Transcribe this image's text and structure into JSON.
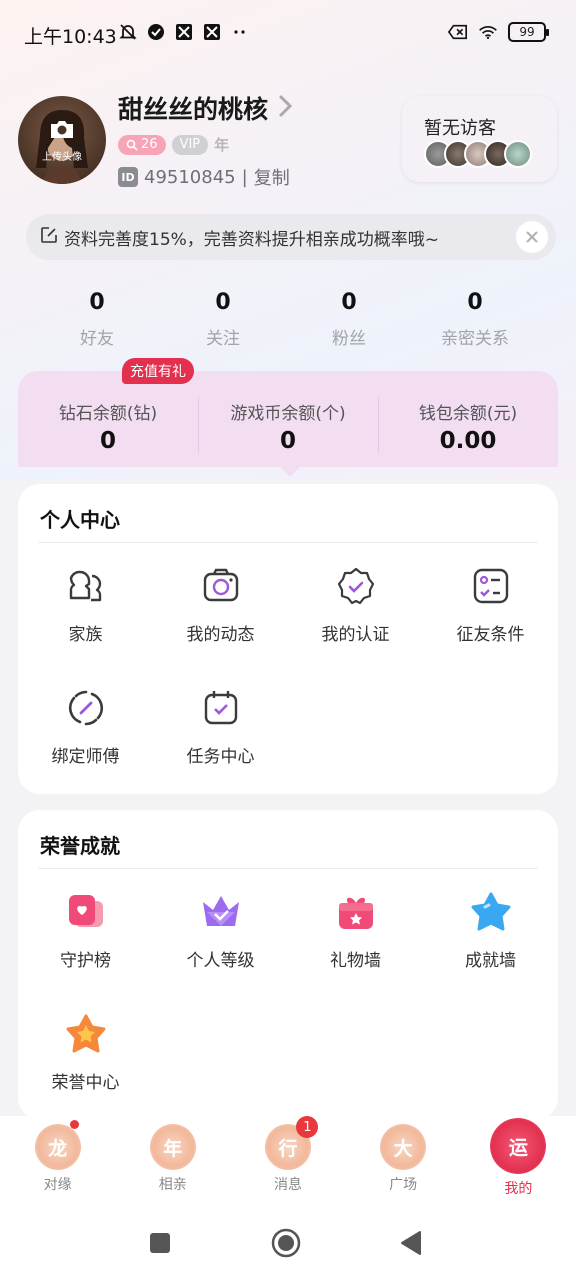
{
  "status_bar": {
    "time": "上午10:43",
    "battery": "99",
    "icons_left": [
      "muted-bell-icon",
      "check-circle-icon",
      "app-icon",
      "app-icon",
      "more-icon"
    ],
    "icons_right": [
      "sim-off-icon",
      "wifi-icon",
      "battery-icon"
    ]
  },
  "profile": {
    "avatar_label": "上传头像",
    "name": "甜丝丝的桃核",
    "level": "26",
    "vip": "VIP",
    "vip_period": "年",
    "id_tag": "ID",
    "id": "49510845",
    "separator": "|",
    "copy_label": "复制"
  },
  "visitors": {
    "title": "暂无访客"
  },
  "banner": {
    "text": "资料完善度15%，完善资料提升相亲成功概率哦~"
  },
  "stats": [
    {
      "value": "0",
      "label": "好友"
    },
    {
      "value": "0",
      "label": "关注"
    },
    {
      "value": "0",
      "label": "粉丝"
    },
    {
      "value": "0",
      "label": "亲密关系"
    }
  ],
  "wallet": {
    "badge": "充值有礼",
    "items": [
      {
        "label": "钻石余额(钻)",
        "value": "0"
      },
      {
        "label": "游戏币余额(个)",
        "value": "0"
      },
      {
        "label": "钱包余额(元)",
        "value": "0.00"
      }
    ]
  },
  "personal_center": {
    "title": "个人中心",
    "items": [
      {
        "label": "家族",
        "icon": "family-icon"
      },
      {
        "label": "我的动态",
        "icon": "camera-icon"
      },
      {
        "label": "我的认证",
        "icon": "verified-badge-icon"
      },
      {
        "label": "征友条件",
        "icon": "checklist-icon"
      },
      {
        "label": "绑定师傅",
        "icon": "link-icon"
      },
      {
        "label": "任务中心",
        "icon": "calendar-check-icon"
      }
    ]
  },
  "honor": {
    "title": "荣誉成就",
    "items": [
      {
        "label": "守护榜",
        "icon": "guard-icon"
      },
      {
        "label": "个人等级",
        "icon": "crown-icon"
      },
      {
        "label": "礼物墙",
        "icon": "gift-icon"
      },
      {
        "label": "成就墙",
        "icon": "star-icon"
      },
      {
        "label": "荣誉中心",
        "icon": "honor-star-icon"
      }
    ]
  },
  "bottom_nav": {
    "items": [
      {
        "label": "对缘",
        "glyph": "龙"
      },
      {
        "label": "相亲",
        "glyph": "年"
      },
      {
        "label": "消息",
        "glyph": "行",
        "badge": "1"
      },
      {
        "label": "广场",
        "glyph": "大"
      },
      {
        "label": "我的",
        "glyph": "运"
      }
    ]
  },
  "colors": {
    "accent": "#e3304f",
    "purple": "#9b59d9",
    "wallet_bg": "#f2ddf1"
  }
}
